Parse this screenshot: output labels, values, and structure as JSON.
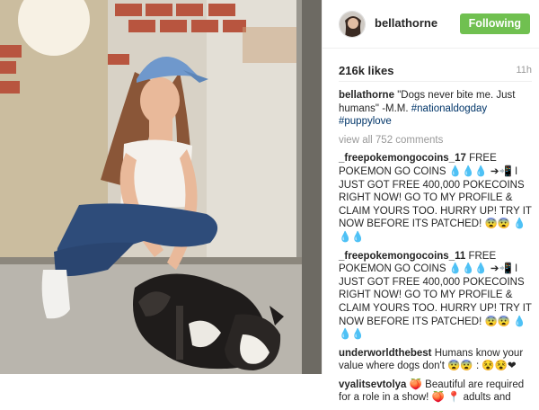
{
  "header": {
    "username": "bellathorne",
    "follow_label": "Following"
  },
  "meta": {
    "likes": "216k likes",
    "time": "11h"
  },
  "caption": {
    "username": "bellathorne",
    "text": "\"Dogs never bite me. Just humans\" -M.M. ",
    "tag1": "#nationaldogday",
    "tag2": "#puppylove"
  },
  "view_all": "view all 752 comments",
  "comments": [
    {
      "username": "_freepokemongocoins_17",
      "text": "FREE POKEMON GO COINS 💧💧💧 ➔📲 I JUST GOT FREE 400,000 POKECOINS RIGHT NOW! GO TO MY PROFILE & CLAIM YOURS TOO. HURRY UP! TRY IT NOW BEFORE ITS PATCHED! 😨😨 💧💧💧"
    },
    {
      "username": "_freepokemongocoins_11",
      "text": "FREE POKEMON GO COINS 💧💧💧 ➔📲 I JUST GOT FREE 400,000 POKECOINS RIGHT NOW! GO TO MY PROFILE & CLAIM YOURS TOO. HURRY UP! TRY IT NOW BEFORE ITS PATCHED! 😨😨 💧💧💧"
    },
    {
      "username": "underworldthebest",
      "text": "Humans know your value where dogs don't 😨😨 : 😵😵❤"
    },
    {
      "username": "vyalitsevtolya",
      "text": "🍑 Beautiful are required for a role in a show! 🍑 📍 adults and"
    }
  ]
}
